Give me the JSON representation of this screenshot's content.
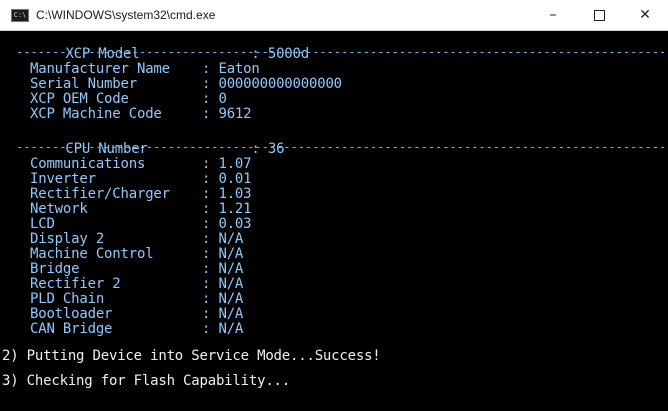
{
  "window": {
    "title": "C:\\WINDOWS\\system32\\cmd.exe",
    "icon": "C:\\",
    "minimize": "–",
    "close": "✕"
  },
  "console": {
    "model": {
      "label": "XCP Model",
      "value": "5000d"
    },
    "info": [
      {
        "label": "Manufacturer Name",
        "value": "Eaton"
      },
      {
        "label": "Serial Number",
        "value": "000000000000000"
      },
      {
        "label": "XCP OEM Code",
        "value": "0"
      },
      {
        "label": "XCP Machine Code",
        "value": "9612"
      }
    ],
    "cpu": {
      "label": "CPU Number",
      "value": "36"
    },
    "versions": [
      {
        "label": "Communications",
        "value": "1.07"
      },
      {
        "label": "Inverter",
        "value": "0.01"
      },
      {
        "label": "Rectifier/Charger",
        "value": "1.03"
      },
      {
        "label": "Network",
        "value": "1.21"
      },
      {
        "label": "LCD",
        "value": "0.03"
      },
      {
        "label": "Display 2",
        "value": "N/A"
      },
      {
        "label": "Machine Control",
        "value": "N/A"
      },
      {
        "label": "Bridge",
        "value": "N/A"
      },
      {
        "label": "Rectifier 2",
        "value": "N/A"
      },
      {
        "label": "PLD Chain",
        "value": "N/A"
      },
      {
        "label": "Bootloader",
        "value": "N/A"
      },
      {
        "label": "CAN Bridge",
        "value": "N/A"
      }
    ],
    "separator": ":",
    "dashes": "--------------------------------------------------------------------------------------------",
    "step2": "2) Putting Device into Service Mode...Success!",
    "step3": "3) Checking for Flash Capability..."
  }
}
